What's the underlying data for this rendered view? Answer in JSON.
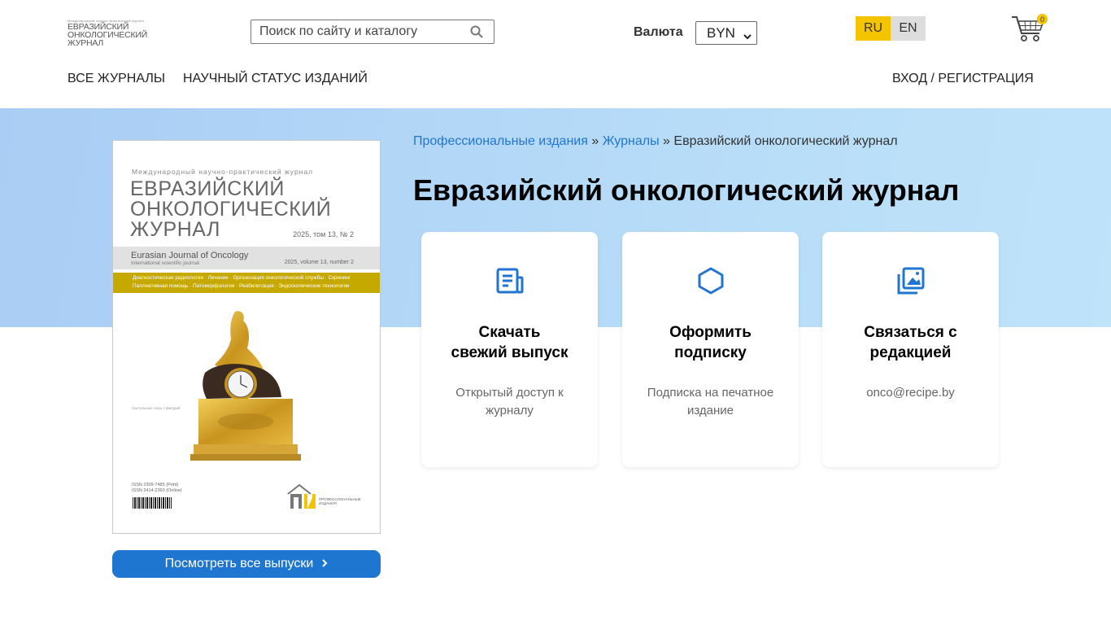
{
  "header": {
    "logo": {
      "tiny": "Международный научно-практический журнал",
      "line1": "ЕВРАЗИЙСКИЙ",
      "line2": "ОНКОЛОГИЧЕСКИЙ",
      "line3": "ЖУРНАЛ"
    },
    "search": {
      "placeholder": "Поиск по сайту и каталогу"
    },
    "currency": {
      "label": "Валюта",
      "selected": "BYN"
    },
    "languages": {
      "ru": "RU",
      "en": "EN",
      "active": "RU"
    },
    "cart": {
      "count": "0"
    },
    "nav": [
      "ВСЕ ЖУРНАЛЫ",
      "НАУЧНЫЙ СТАТУС ИЗДАНИЙ"
    ],
    "login": "ВХОД / РЕГИСТРАЦИЯ"
  },
  "breadcrumb": {
    "items": [
      "Профессиональные издания",
      "Журналы",
      "Евразийский онкологический журнал"
    ],
    "separator": "»"
  },
  "page_title": "Евразийский онкологический журнал",
  "cover": {
    "intl": "Международный научно-практический журнал",
    "title_lines": [
      "ЕВРАЗИЙСКИЙ",
      "ОНКОЛОГИЧЕСКИЙ",
      "ЖУРНАЛ"
    ],
    "issue_ru": "2025, том 13, № 2",
    "title_en": "Eurasian Journal of Oncology",
    "subtitle_en": "International scientific journal",
    "issue_en": "2025, volume 13, number 2",
    "topics_row1": "Диагностическая радиология · Лечение · Организация онкологической службы · Скрининг",
    "topics_row2": "Паллиативная помощь · Патоморфология · Реабилитация · Эндоскопические технологии",
    "caption": "Настольные часы с фигурой",
    "issn_print": "ISSN 2309-7485 (Print)",
    "issn_online": "ISSN 2414-2360 (Online)",
    "publisher": "ПРОФЕССИОНАЛЬНЫЕ ИЗДАНИЯ"
  },
  "all_issues_button": "Посмотреть все выпуски",
  "cards": [
    {
      "icon": "document-icon",
      "title_l1": "Скачать",
      "title_l2": "свежий выпуск",
      "desc_l1": "Открытый доступ к",
      "desc_l2": "журналу"
    },
    {
      "icon": "cube-icon",
      "title_l1": "Оформить",
      "title_l2": "подписку",
      "desc_l1": "Подписка на печатное",
      "desc_l2": "издание"
    },
    {
      "icon": "image-gallery-icon",
      "title_l1": "Связаться с",
      "title_l2": "редакцией",
      "desc_l1": "onco@recipe.by",
      "desc_l2": ""
    }
  ],
  "colors": {
    "accent": "#1f76d0",
    "lang_active": "#f5c400",
    "hero_start": "#a9cdf4",
    "hero_end": "#bfe3f9"
  }
}
